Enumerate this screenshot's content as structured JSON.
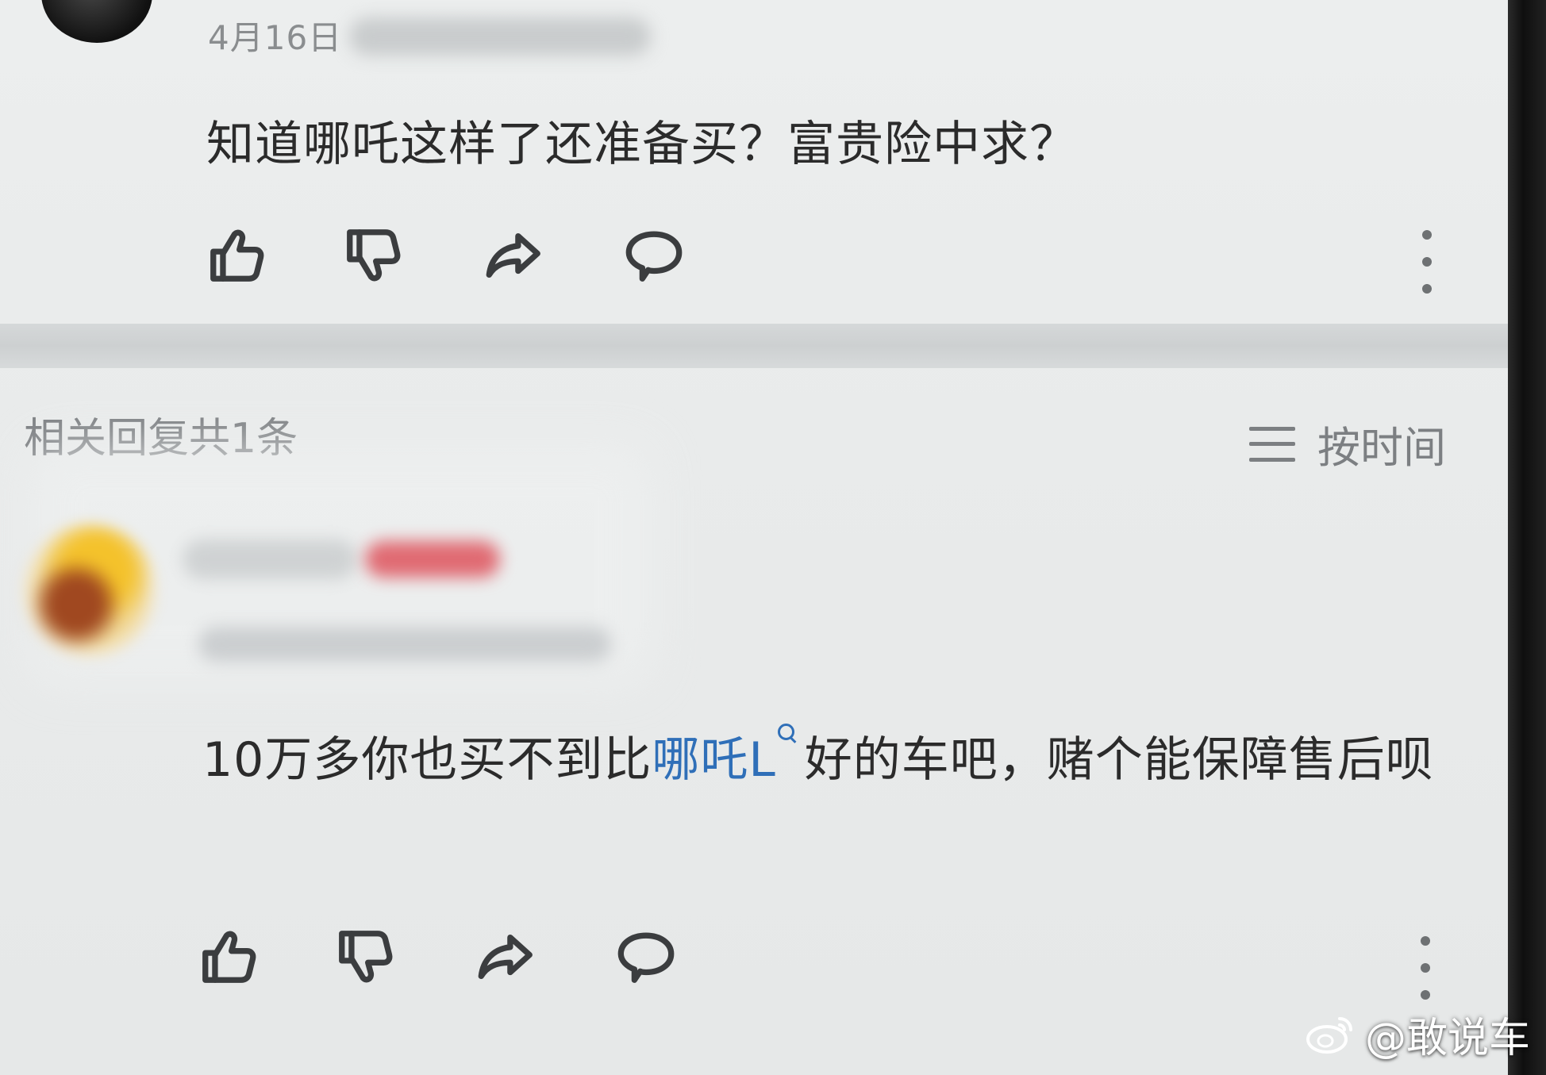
{
  "top_comment": {
    "date": "4月16日",
    "text": "知道哪吒这样了还准备买？富贵险中求？"
  },
  "replies_section": {
    "header": "相关回复共1条",
    "sort_label": "按时间"
  },
  "reply": {
    "text_before_link": "10万多你也买不到比",
    "link_text": "哪吒L",
    "text_after_link": "好的车吧，赌个能保障售后呗"
  },
  "icons": {
    "like": "thumbs-up-icon",
    "dislike": "thumbs-down-icon",
    "share": "share-icon",
    "comment": "comment-icon",
    "more": "more-icon",
    "sort": "sort-icon",
    "search": "search-icon",
    "weibo": "weibo-icon"
  },
  "colors": {
    "link": "#2f6fb8",
    "muted_text": "#7c7f82",
    "body_text": "#2b2b2b"
  },
  "watermark": {
    "text": "@敢说车"
  }
}
